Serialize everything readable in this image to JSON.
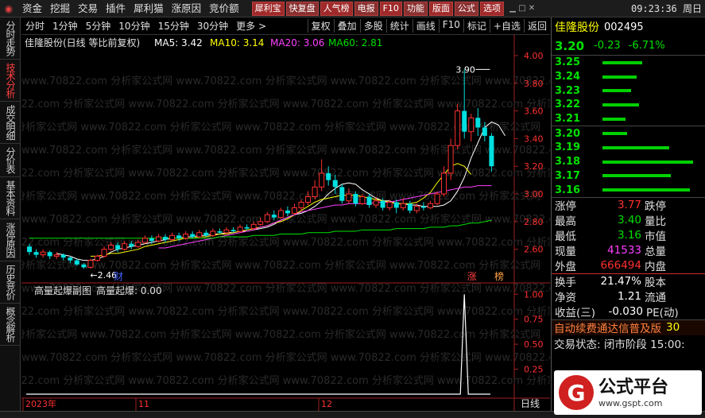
{
  "menubar": {
    "items": [
      "资金",
      "挖掘",
      "交易",
      "插件",
      "犀利猫",
      "涨原因",
      "竞价额"
    ],
    "quick_buttons": [
      "犀利宝",
      "快复盘",
      "人气榜",
      "电报",
      "F10",
      "功能",
      "版面",
      "公式",
      "选项"
    ],
    "clock": "09:23:36 周日"
  },
  "left_tabs": [
    "分时走势",
    "技术分析",
    "成交明细",
    "分价表",
    "基本资料",
    "涨停原因",
    "历史竞价",
    "概念解析"
  ],
  "left_tab_active": 1,
  "toolbar": {
    "periods": [
      "分时",
      "1分钟",
      "5分钟",
      "10分钟",
      "15分钟",
      "30分钟",
      "更多 >"
    ],
    "tools": [
      "复权",
      "叠加",
      "多股",
      "统计",
      "画线",
      "F10",
      "标记",
      "+自选",
      "返回"
    ]
  },
  "main_legend": {
    "title": "佳隆股份(日线 等比前复权)",
    "ma": [
      {
        "label": "MA5: 3.42",
        "color": "#ffffff"
      },
      {
        "label": "MA10: 3.14",
        "color": "#ffff00"
      },
      {
        "label": "MA20: 3.06",
        "color": "#ff40ff"
      },
      {
        "label": "MA60: 2.81",
        "color": "#00e000"
      }
    ]
  },
  "sub_legend": {
    "title": "高量起爆副图",
    "value": "高量起爆: 0.00"
  },
  "watermark": "www.70822.com 分析家公式网",
  "chart_data": {
    "type": "candlestick",
    "price_axis": {
      "ticks": [
        4.0,
        3.8,
        3.6,
        3.4,
        3.2,
        3.0,
        2.8,
        2.6
      ],
      "range": [
        2.38,
        4.08
      ]
    },
    "sub_axis": {
      "ticks": [
        1.0,
        0.75,
        0.5,
        0.25
      ],
      "range": [
        0,
        1.05
      ]
    },
    "x_labels": [
      "2023年",
      "11",
      "12"
    ],
    "annotations": [
      {
        "text": "3.90",
        "value": 3.9,
        "index": 68
      },
      {
        "text": "2.46",
        "value": 2.46,
        "index": 8
      }
    ],
    "markers": [
      {
        "text": "财",
        "index": 13,
        "color": "#4060ff"
      },
      {
        "text": "涨",
        "index": 65,
        "color": "#ff4040"
      },
      {
        "text": "榜",
        "index": 69,
        "color": "#ffa040"
      }
    ],
    "candles": [
      [
        2.62,
        2.58,
        2.64,
        2.56
      ],
      [
        2.58,
        2.56,
        2.6,
        2.54
      ],
      [
        2.56,
        2.58,
        2.6,
        2.54
      ],
      [
        2.58,
        2.55,
        2.59,
        2.53
      ],
      [
        2.55,
        2.56,
        2.58,
        2.53
      ],
      [
        2.56,
        2.54,
        2.57,
        2.52
      ],
      [
        2.54,
        2.52,
        2.55,
        2.5
      ],
      [
        2.52,
        2.49,
        2.53,
        2.48
      ],
      [
        2.49,
        2.47,
        2.5,
        2.46
      ],
      [
        2.47,
        2.52,
        2.53,
        2.46
      ],
      [
        2.52,
        2.55,
        2.56,
        2.51
      ],
      [
        2.55,
        2.6,
        2.62,
        2.54
      ],
      [
        2.6,
        2.63,
        2.65,
        2.59
      ],
      [
        2.63,
        2.6,
        2.65,
        2.58
      ],
      [
        2.6,
        2.64,
        2.66,
        2.59
      ],
      [
        2.64,
        2.62,
        2.66,
        2.6
      ],
      [
        2.62,
        2.65,
        2.67,
        2.61
      ],
      [
        2.65,
        2.68,
        2.7,
        2.64
      ],
      [
        2.68,
        2.66,
        2.7,
        2.64
      ],
      [
        2.66,
        2.69,
        2.71,
        2.65
      ],
      [
        2.69,
        2.67,
        2.71,
        2.65
      ],
      [
        2.67,
        2.7,
        2.72,
        2.66
      ],
      [
        2.7,
        2.68,
        2.72,
        2.66
      ],
      [
        2.68,
        2.71,
        2.73,
        2.67
      ],
      [
        2.71,
        2.69,
        2.73,
        2.68
      ],
      [
        2.69,
        2.72,
        2.74,
        2.68
      ],
      [
        2.72,
        2.7,
        2.74,
        2.69
      ],
      [
        2.7,
        2.73,
        2.75,
        2.69
      ],
      [
        2.73,
        2.72,
        2.75,
        2.71
      ],
      [
        2.72,
        2.74,
        2.76,
        2.71
      ],
      [
        2.74,
        2.73,
        2.76,
        2.72
      ],
      [
        2.73,
        2.76,
        2.78,
        2.72
      ],
      [
        2.76,
        2.75,
        2.78,
        2.74
      ],
      [
        2.75,
        2.78,
        2.8,
        2.74
      ],
      [
        2.78,
        2.8,
        2.83,
        2.77
      ],
      [
        2.8,
        2.85,
        2.87,
        2.79
      ],
      [
        2.85,
        2.83,
        2.88,
        2.81
      ],
      [
        2.83,
        2.88,
        2.9,
        2.82
      ],
      [
        2.88,
        2.86,
        2.91,
        2.84
      ],
      [
        2.86,
        2.9,
        2.93,
        2.85
      ],
      [
        2.9,
        2.94,
        2.96,
        2.88
      ],
      [
        2.94,
        2.98,
        3.02,
        2.92
      ],
      [
        2.98,
        3.05,
        3.1,
        2.96
      ],
      [
        3.05,
        3.15,
        3.25,
        3.02
      ],
      [
        3.15,
        3.1,
        3.2,
        3.06
      ],
      [
        3.1,
        3.05,
        3.14,
        3.0
      ],
      [
        3.05,
        2.95,
        3.07,
        2.93
      ],
      [
        2.95,
        3.0,
        3.04,
        2.93
      ],
      [
        3.0,
        2.93,
        3.02,
        2.91
      ],
      [
        2.93,
        2.98,
        3.0,
        2.92
      ],
      [
        2.98,
        2.92,
        3.0,
        2.9
      ],
      [
        2.92,
        2.95,
        2.98,
        2.9
      ],
      [
        2.95,
        2.9,
        2.97,
        2.88
      ],
      [
        2.9,
        2.94,
        2.96,
        2.88
      ],
      [
        2.94,
        2.9,
        2.96,
        2.86
      ],
      [
        2.9,
        2.93,
        2.97,
        2.88
      ],
      [
        2.93,
        2.88,
        2.95,
        2.86
      ],
      [
        2.88,
        2.91,
        2.93,
        2.86
      ],
      [
        2.91,
        2.9,
        2.94,
        2.88
      ],
      [
        2.9,
        2.93,
        2.95,
        2.89
      ],
      [
        2.93,
        3.0,
        3.02,
        2.92
      ],
      [
        3.0,
        3.15,
        3.2,
        2.98
      ],
      [
        3.15,
        3.35,
        3.4,
        3.1
      ],
      [
        3.35,
        3.6,
        3.65,
        3.32
      ],
      [
        3.6,
        3.45,
        3.9,
        3.4
      ],
      [
        3.45,
        3.55,
        3.58,
        3.38
      ],
      [
        3.55,
        3.48,
        3.62,
        3.42
      ],
      [
        3.48,
        3.42,
        3.52,
        3.38
      ],
      [
        3.42,
        3.2,
        3.44,
        3.16
      ]
    ],
    "ma": {
      "ma5": {
        "color": "#ffffff",
        "start": 4,
        "values": [
          2.57,
          2.56,
          2.55,
          2.53,
          2.52,
          2.52,
          2.53,
          2.55,
          2.58,
          2.6,
          2.61,
          2.62,
          2.63,
          2.64,
          2.65,
          2.66,
          2.67,
          2.68,
          2.68,
          2.69,
          2.69,
          2.7,
          2.7,
          2.71,
          2.71,
          2.72,
          2.72,
          2.73,
          2.73,
          2.74,
          2.75,
          2.76,
          2.78,
          2.81,
          2.83,
          2.85,
          2.86,
          2.88,
          2.91,
          2.95,
          3.0,
          3.04,
          3.07,
          3.08,
          3.07,
          3.03,
          3.0,
          2.97,
          2.95,
          2.95,
          2.93,
          2.93,
          2.92,
          2.92,
          2.91,
          2.91,
          2.91,
          2.92,
          2.95,
          3.02,
          3.12,
          3.26,
          3.37,
          3.48,
          3.52,
          3.5,
          3.42
        ]
      },
      "ma10": {
        "color": "#ffff00",
        "start": 9,
        "values": [
          2.55,
          2.55,
          2.56,
          2.57,
          2.57,
          2.58,
          2.59,
          2.6,
          2.62,
          2.63,
          2.64,
          2.65,
          2.66,
          2.67,
          2.68,
          2.68,
          2.69,
          2.69,
          2.7,
          2.71,
          2.71,
          2.72,
          2.73,
          2.74,
          2.75,
          2.76,
          2.77,
          2.79,
          2.8,
          2.82,
          2.85,
          2.88,
          2.91,
          2.94,
          2.96,
          2.97,
          2.98,
          2.99,
          2.99,
          2.99,
          2.98,
          2.97,
          2.96,
          2.95,
          2.94,
          2.93,
          2.93,
          2.93,
          2.94,
          2.97,
          3.01,
          3.08,
          3.14,
          3.2,
          3.22,
          3.2,
          3.14
        ]
      },
      "ma20": {
        "color": "#ff40ff",
        "start": 19,
        "values": [
          2.61,
          2.61,
          2.62,
          2.63,
          2.64,
          2.65,
          2.66,
          2.67,
          2.68,
          2.69,
          2.7,
          2.71,
          2.72,
          2.73,
          2.74,
          2.76,
          2.77,
          2.79,
          2.81,
          2.83,
          2.85,
          2.87,
          2.88,
          2.89,
          2.9,
          2.91,
          2.92,
          2.92,
          2.93,
          2.93,
          2.93,
          2.93,
          2.94,
          2.94,
          2.94,
          2.95,
          2.96,
          2.97,
          2.98,
          2.99,
          3.0,
          3.01,
          3.02,
          3.03,
          3.04,
          3.05,
          3.05,
          3.06,
          3.06,
          3.06
        ]
      },
      "ma60": {
        "color": "#00e000",
        "start": 0,
        "values": [
          2.68,
          2.68,
          2.68,
          2.68,
          2.68,
          2.68,
          2.68,
          2.68,
          2.68,
          2.68,
          2.68,
          2.68,
          2.68,
          2.68,
          2.68,
          2.68,
          2.68,
          2.68,
          2.68,
          2.68,
          2.68,
          2.68,
          2.68,
          2.68,
          2.68,
          2.68,
          2.68,
          2.68,
          2.69,
          2.69,
          2.69,
          2.69,
          2.69,
          2.7,
          2.7,
          2.7,
          2.7,
          2.71,
          2.71,
          2.71,
          2.71,
          2.72,
          2.72,
          2.72,
          2.72,
          2.73,
          2.73,
          2.73,
          2.73,
          2.74,
          2.74,
          2.74,
          2.74,
          2.74,
          2.75,
          2.75,
          2.75,
          2.75,
          2.75,
          2.76,
          2.76,
          2.76,
          2.77,
          2.77,
          2.78,
          2.79,
          2.79,
          2.8,
          2.81
        ]
      }
    },
    "signal": {
      "index": 64,
      "peak": 1.0
    }
  },
  "quote": {
    "name": "佳隆股份",
    "code": "002495",
    "price": "3.20",
    "change": "-0.23",
    "pct": "-6.71%"
  },
  "orderbook": {
    "asks": [
      {
        "p": "3.25",
        "v": 0.42
      },
      {
        "p": "3.24",
        "v": 0.36
      },
      {
        "p": "3.23",
        "v": 0.3
      },
      {
        "p": "3.22",
        "v": 0.38
      },
      {
        "p": "3.21",
        "v": 0.24
      }
    ],
    "bids": [
      {
        "p": "3.20",
        "v": 0.26
      },
      {
        "p": "3.19",
        "v": 0.7
      },
      {
        "p": "3.18",
        "v": 0.95
      },
      {
        "p": "3.17",
        "v": 0.72
      },
      {
        "p": "3.16",
        "v": 0.92
      }
    ]
  },
  "stats": [
    {
      "l": "涨停",
      "v": "3.77",
      "c": "red",
      "l2": "跌停"
    },
    {
      "l": "最高",
      "v": "3.40",
      "c": "green",
      "l2": "量比"
    },
    {
      "l": "最低",
      "v": "3.16",
      "c": "green",
      "l2": "市值"
    },
    {
      "l": "现量",
      "v": "41533",
      "c": "magenta",
      "l2": "总量"
    },
    {
      "l": "外盘",
      "v": "666494",
      "c": "red",
      "l2": "内盘"
    }
  ],
  "stats2": [
    {
      "l": "换手",
      "v": "21.47%",
      "c": "white",
      "l2": "股本"
    },
    {
      "l": "净资",
      "v": "1.21",
      "c": "white",
      "l2": "流通"
    },
    {
      "l": "收益(三)",
      "v": "-0.030",
      "c": "white",
      "l2": "PE(动)"
    }
  ],
  "ad": {
    "text": "自动续费通达信普及版",
    "tail": "30"
  },
  "trade_status": "交易状态: 闭市阶段 15:00:",
  "bottom_tab": "日线",
  "site_logo": {
    "title": "公式平台",
    "url": "www.gspt.com"
  }
}
